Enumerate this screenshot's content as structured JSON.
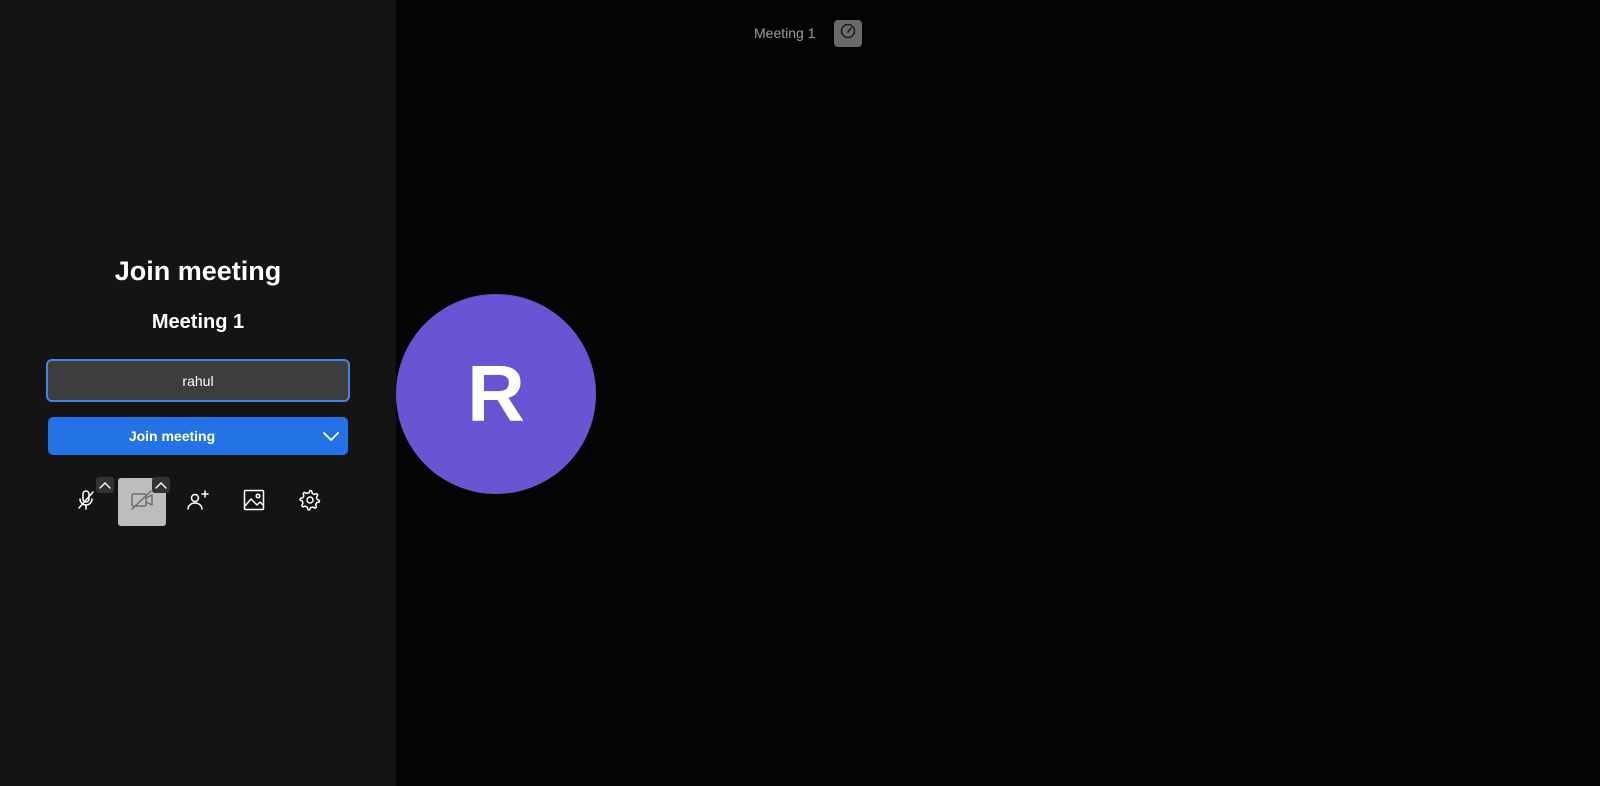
{
  "prejoin": {
    "title": "Join meeting",
    "meeting_name": "Meeting 1",
    "display_name_value": "rahul",
    "join_button_label": "Join meeting"
  },
  "toolbar": {
    "items": [
      {
        "icon": "microphone-muted-icon",
        "state": "muted"
      },
      {
        "icon": "camera-off-icon",
        "state": "off"
      },
      {
        "icon": "invite-person-icon"
      },
      {
        "icon": "background-image-icon"
      },
      {
        "icon": "settings-gear-icon"
      }
    ]
  },
  "stage": {
    "meeting_label": "Meeting 1",
    "avatar_initial": "R",
    "avatar_color": "#6a54d4"
  },
  "colors": {
    "accent": "#2372e6",
    "panel_bg": "#141414",
    "stage_bg": "#040404"
  }
}
